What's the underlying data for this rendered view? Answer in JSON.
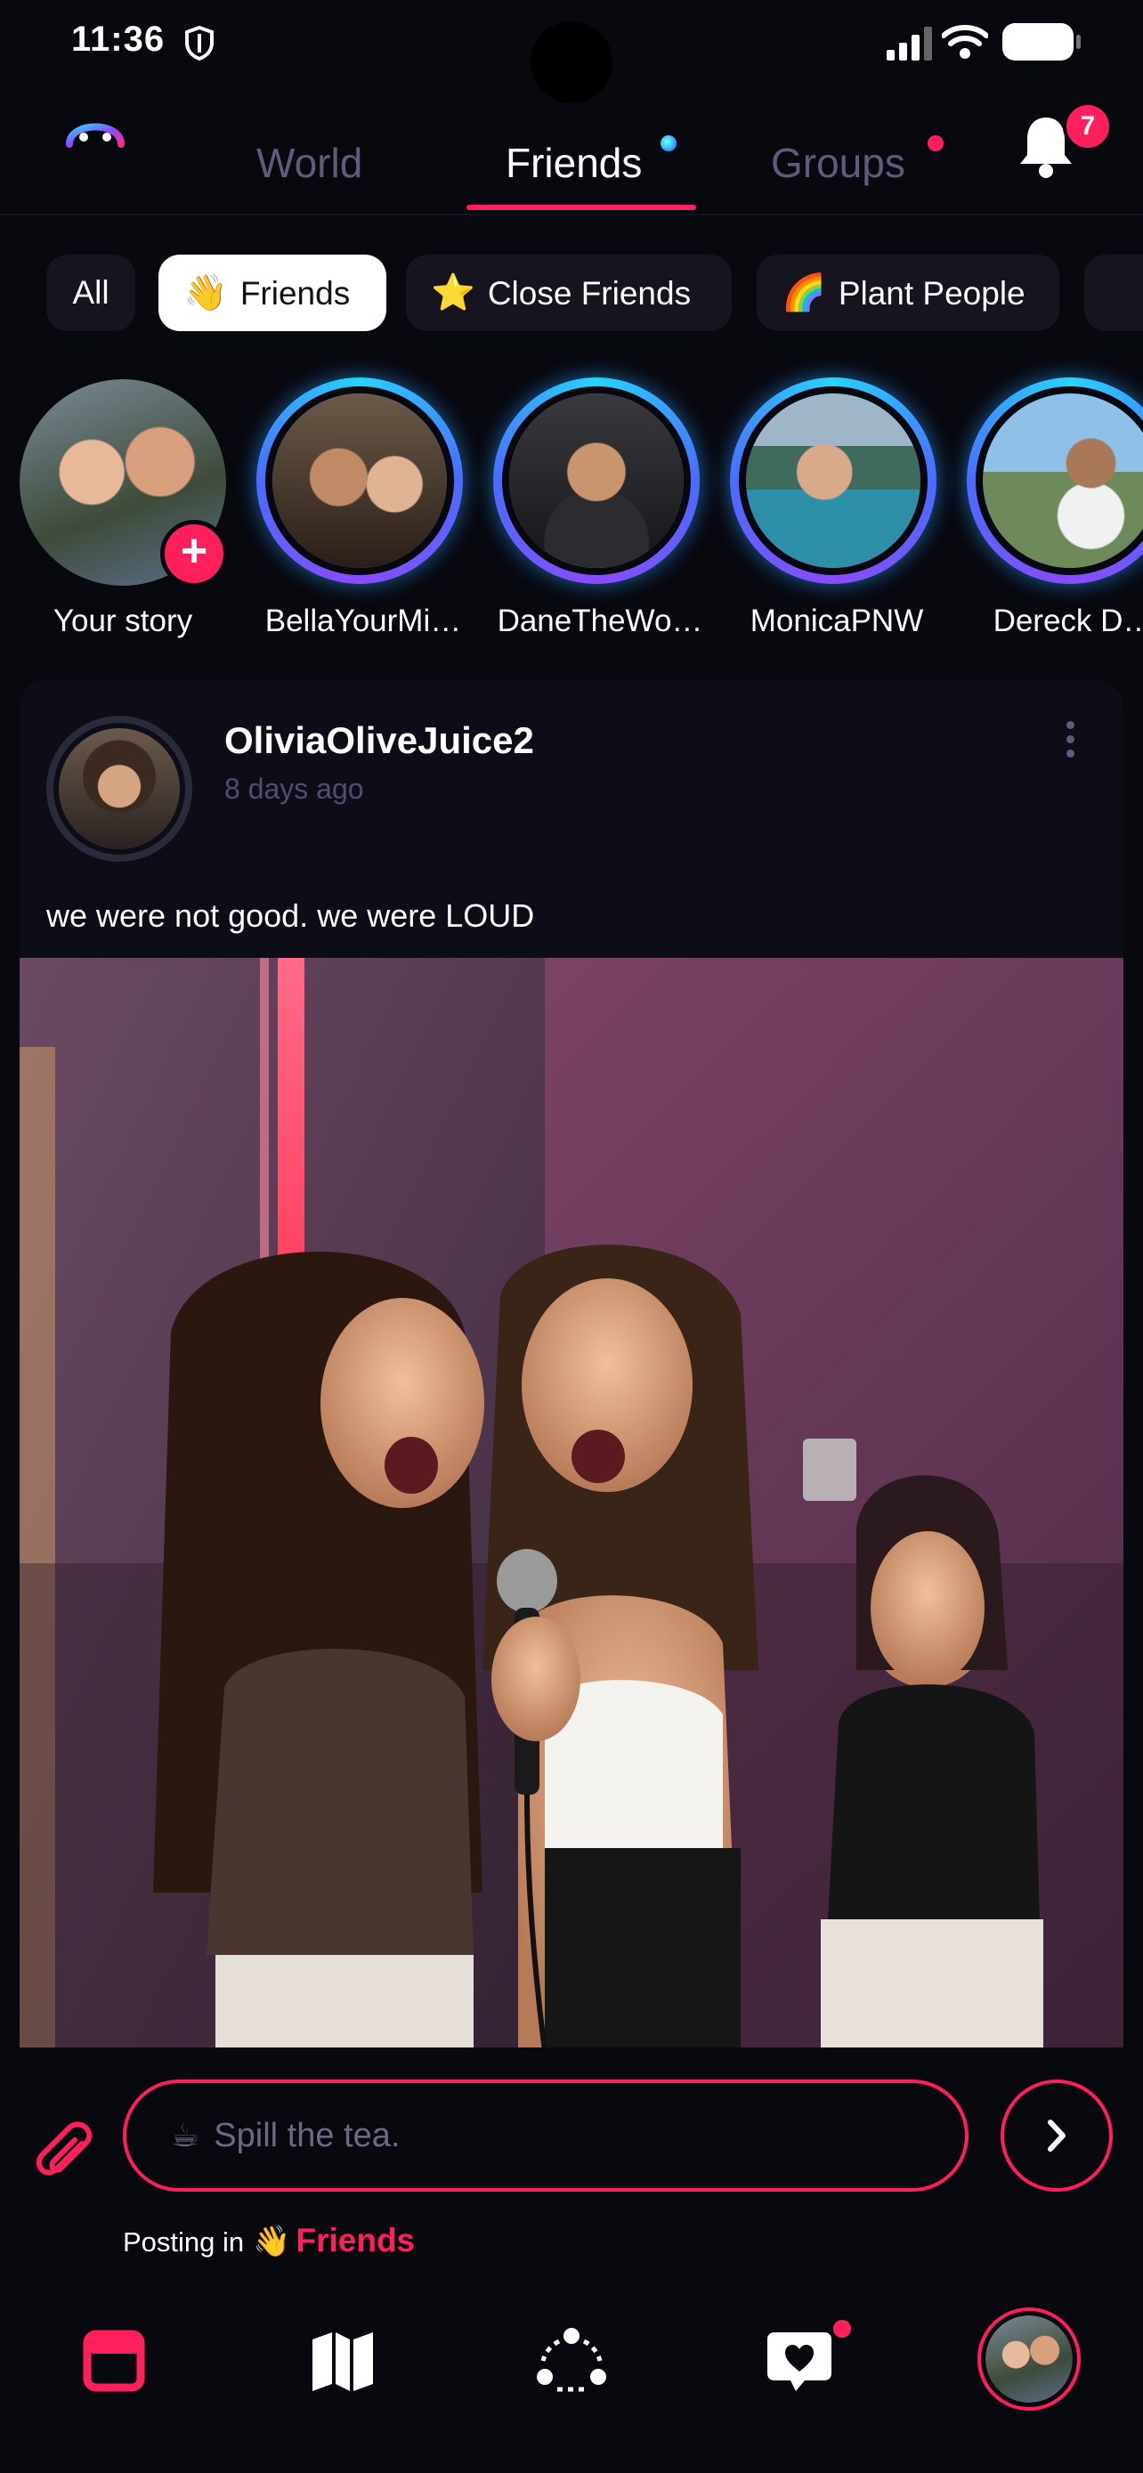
{
  "status_bar": {
    "time": "11:36"
  },
  "header": {
    "tabs": [
      {
        "label": "World",
        "active": false
      },
      {
        "label": "Friends",
        "active": true
      },
      {
        "label": "Groups",
        "active": false
      }
    ],
    "notification_count": "7"
  },
  "chips": [
    {
      "label": "All",
      "emoji": "",
      "active": false
    },
    {
      "label": "Friends",
      "emoji": "👋",
      "active": true
    },
    {
      "label": "Close Friends",
      "emoji": "⭐",
      "active": false
    },
    {
      "label": "Plant People",
      "emoji": "🌈",
      "active": false
    }
  ],
  "stories": [
    {
      "name": "Your story",
      "own": true
    },
    {
      "name": "BellaYourMi…"
    },
    {
      "name": "DaneTheWo…"
    },
    {
      "name": "MonicaPNW"
    },
    {
      "name": "Dereck D…"
    }
  ],
  "post": {
    "username": "OliviaOliveJuice2",
    "time_ago": "8 days ago",
    "text": "we were not good. we were LOUD"
  },
  "composer": {
    "emoji": "☕",
    "placeholder": "Spill the tea.",
    "posting_in_label": "Posting in",
    "group_emoji": "👋",
    "group_name": "Friends"
  },
  "colors": {
    "accent": "#ff1f5a",
    "background": "#08080f",
    "story_ring": "#27d3ff",
    "muted_text": "#5e5c7c"
  },
  "icons": [
    "shield-icon",
    "signal-icon",
    "wifi-icon",
    "battery-icon",
    "logo-icon",
    "bell-icon",
    "plus-icon",
    "more-vertical-icon",
    "paperclip-icon",
    "chevron-right-icon",
    "feed-icon",
    "map-icon",
    "people-icon",
    "chat-heart-icon"
  ]
}
